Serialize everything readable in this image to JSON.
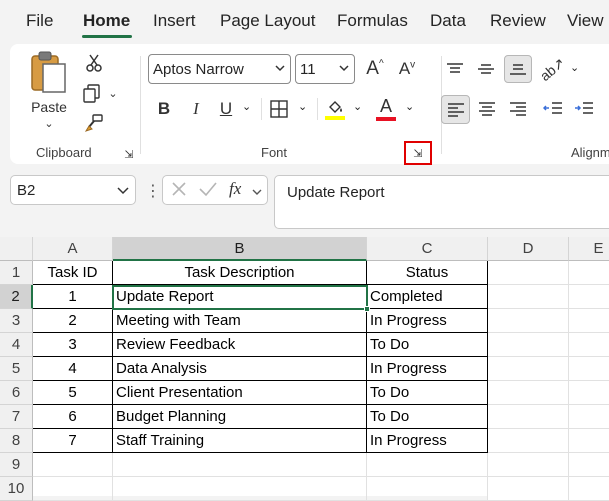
{
  "menu": {
    "tabs": [
      "File",
      "Home",
      "Insert",
      "Page Layout",
      "Formulas",
      "Data",
      "Review",
      "View"
    ],
    "active": "Home"
  },
  "ribbon": {
    "clipboard": {
      "paste_label": "Paste",
      "group_label": "Clipboard"
    },
    "font": {
      "font_name": "Aptos Narrow",
      "font_size": "11",
      "group_label": "Font",
      "font_color": "#e81123",
      "highlight_color": "#ffff00"
    },
    "alignment": {
      "group_label": "Alignm"
    }
  },
  "formula_bar": {
    "name_box": "B2",
    "formula": "Update Report"
  },
  "sheet": {
    "columns": [
      "A",
      "B",
      "C",
      "D",
      "E"
    ],
    "rows": [
      "1",
      "2",
      "3",
      "4",
      "5",
      "6",
      "7",
      "8",
      "9",
      "10"
    ],
    "headers": [
      "Task ID",
      "Task Description",
      "Status"
    ],
    "data": [
      [
        "1",
        "Update Report",
        "Completed"
      ],
      [
        "2",
        "Meeting with Team",
        "In Progress"
      ],
      [
        "3",
        "Review Feedback",
        "To Do"
      ],
      [
        "4",
        "Data Analysis",
        "In Progress"
      ],
      [
        "5",
        "Client Presentation",
        "To Do"
      ],
      [
        "6",
        "Budget Planning",
        "To Do"
      ],
      [
        "7",
        "Staff Training",
        "In Progress"
      ]
    ],
    "active_cell": "B2",
    "accent": "#217346"
  }
}
